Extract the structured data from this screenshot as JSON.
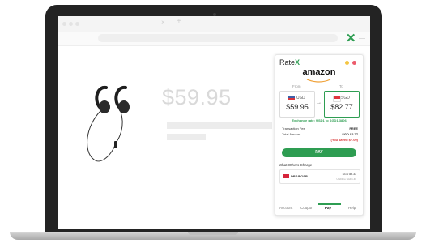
{
  "browser": {
    "tab_close": "×",
    "tab_new": "+",
    "extension_icon": "x-logo-icon"
  },
  "product": {
    "price": "$59.95",
    "image": "earphones-icon"
  },
  "popup": {
    "brand_prefix": "Rate",
    "brand_suffix": "X",
    "store": "amazon",
    "from_label": "From",
    "to_label": "To",
    "from_code": "USD",
    "from_amount": "$59.95",
    "to_code": "SGD",
    "to_amount": "$82.77",
    "arrow": "→",
    "exchange_rate": "Exchange rate: USD1 to SGD1.3806",
    "transaction_fee_label": "Transaction Fee",
    "transaction_fee_value": "FREE",
    "total_amount_label": "Total Amount",
    "total_amount_value": "SGD $2.77",
    "saved": "(You saved $7.00)",
    "pay_label": "PAY",
    "others_heading": "What Others Charge",
    "other_bank": "DBS/POSB",
    "other_value": "SGD 89.33",
    "other_sub": "USD1 to SGD1.46",
    "nav": [
      "Account",
      "Coupon",
      "Pay",
      "Help"
    ],
    "active_tab": "Pay"
  },
  "colors": {
    "accent": "#2e9d52",
    "saved_red": "#d93b3b",
    "dot_yellow": "#f4c542",
    "dot_red": "#ec5b6b"
  }
}
